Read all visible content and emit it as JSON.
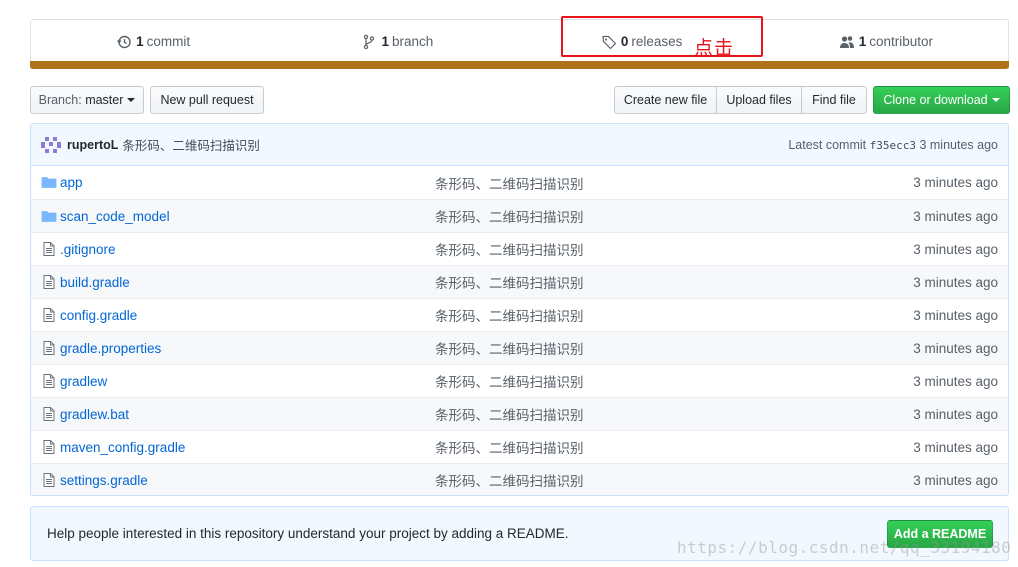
{
  "summary": {
    "commits": {
      "count": "1",
      "label": "commit",
      "icon": "history-icon"
    },
    "branches": {
      "count": "1",
      "label": "branch",
      "icon": "git-branch-icon"
    },
    "releases": {
      "count": "0",
      "label": "releases",
      "icon": "tag-icon"
    },
    "contributors": {
      "count": "1",
      "label": "contributor",
      "icon": "people-icon"
    }
  },
  "language_bar_color": "#b07219",
  "annotation": {
    "label": "点击",
    "color": "#e8141b"
  },
  "toolbar": {
    "branch_prefix": "Branch:",
    "branch_name": "master",
    "new_pull_request": "New pull request",
    "create_new_file": "Create new file",
    "upload_files": "Upload files",
    "find_file": "Find file",
    "clone_or_download": "Clone or download"
  },
  "commit_tease": {
    "author": "rupertoL",
    "message": "条形码、二维码扫描识别",
    "latest_label": "Latest commit",
    "sha": "f35ecc3",
    "age": "3 minutes ago"
  },
  "files": [
    {
      "name": "app",
      "type": "dir",
      "message": "条形码、二维码扫描识别",
      "age": "3 minutes ago"
    },
    {
      "name": "scan_code_model",
      "type": "dir",
      "message": "条形码、二维码扫描识别",
      "age": "3 minutes ago"
    },
    {
      "name": ".gitignore",
      "type": "file",
      "message": "条形码、二维码扫描识别",
      "age": "3 minutes ago"
    },
    {
      "name": "build.gradle",
      "type": "file",
      "message": "条形码、二维码扫描识别",
      "age": "3 minutes ago"
    },
    {
      "name": "config.gradle",
      "type": "file",
      "message": "条形码、二维码扫描识别",
      "age": "3 minutes ago"
    },
    {
      "name": "gradle.properties",
      "type": "file",
      "message": "条形码、二维码扫描识别",
      "age": "3 minutes ago"
    },
    {
      "name": "gradlew",
      "type": "file",
      "message": "条形码、二维码扫描识别",
      "age": "3 minutes ago"
    },
    {
      "name": "gradlew.bat",
      "type": "file",
      "message": "条形码、二维码扫描识别",
      "age": "3 minutes ago"
    },
    {
      "name": "maven_config.gradle",
      "type": "file",
      "message": "条形码、二维码扫描识别",
      "age": "3 minutes ago"
    },
    {
      "name": "settings.gradle",
      "type": "file",
      "message": "条形码、二维码扫描识别",
      "age": "3 minutes ago"
    }
  ],
  "readme_prompt": {
    "text": "Help people interested in this repository understand your project by adding a README.",
    "button": "Add a README"
  },
  "watermark": "https://blog.csdn.net/qq_33194180"
}
